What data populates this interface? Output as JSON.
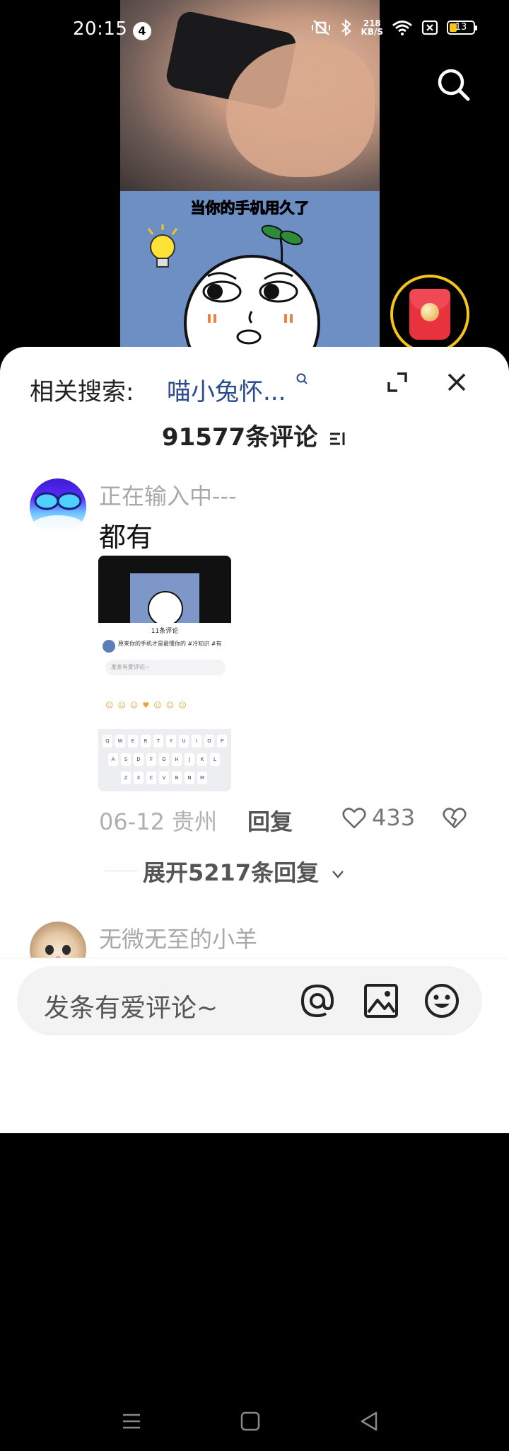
{
  "status_bar": {
    "time": "20:15",
    "notification_count": "4",
    "net_speed_value": "218",
    "net_speed_unit": "KB/S",
    "battery": "13"
  },
  "video": {
    "caption": "当你的手机用久了"
  },
  "panel": {
    "related_label": "相关搜索:",
    "related_query": "喵小兔怀...",
    "comment_count": "91577条评论"
  },
  "comments": [
    {
      "username": "正在输入中---",
      "text": "都有",
      "date_location": "06-12 贵州",
      "reply_label": "回复",
      "likes": "433",
      "expand_label": "展开5217条回复",
      "thumbnail": {
        "title": "11条评论",
        "comment_preview": "原来你的手机才是最懂你的 #冷知识 #有",
        "input_placeholder": "发条有爱评论~",
        "keys_row1": [
          "Q",
          "W",
          "E",
          "R",
          "T",
          "Y",
          "U",
          "I",
          "O",
          "P"
        ],
        "keys_row2": [
          "A",
          "S",
          "D",
          "F",
          "G",
          "H",
          "J",
          "K",
          "L"
        ],
        "keys_row3": [
          "Z",
          "X",
          "C",
          "V",
          "B",
          "N",
          "M"
        ]
      }
    },
    {
      "username": "无微无至的小羊"
    }
  ],
  "input_bar": {
    "placeholder": "发条有爱评论~"
  },
  "icons": {
    "search": "search-icon",
    "red_packet": "red-packet-icon",
    "expand": "expand-icon",
    "close": "close-icon",
    "sort": "sort-icon",
    "like": "heart-icon",
    "dislike": "broken-heart-icon",
    "at": "at-icon",
    "image": "image-icon",
    "emoji": "emoji-icon"
  },
  "colors": {
    "link": "#2b4b8c",
    "red_packet": "#e8333e",
    "ring": "#f5c518",
    "cartoon_bg": "#6e8fc4"
  }
}
